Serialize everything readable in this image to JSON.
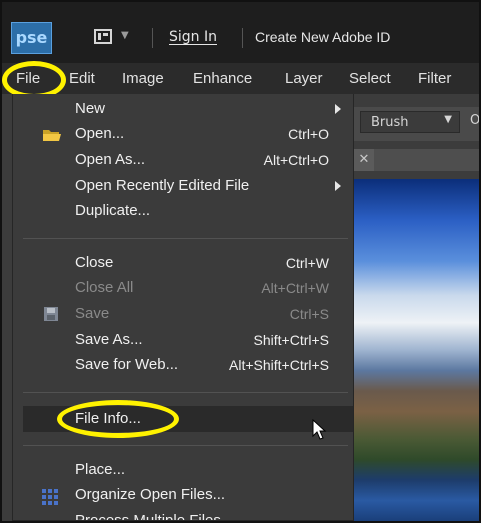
{
  "titlebar": {
    "app_logo": "pse",
    "sign_in": "Sign In",
    "create_id": "Create New Adobe ID"
  },
  "menubar": {
    "items": [
      "File",
      "Edit",
      "Image",
      "Enhance",
      "Layer",
      "Select",
      "Filter"
    ]
  },
  "tool_options": {
    "brush_label": "Brush",
    "trailing_text": "O"
  },
  "file_menu": {
    "items": [
      {
        "label": "New",
        "shortcut": "",
        "submenu": true,
        "enabled": true
      },
      {
        "label": "Open...",
        "shortcut": "Ctrl+O",
        "submenu": false,
        "enabled": true,
        "icon": "folder-icon"
      },
      {
        "label": "Open As...",
        "shortcut": "Alt+Ctrl+O",
        "submenu": false,
        "enabled": true
      },
      {
        "label": "Open Recently Edited File",
        "shortcut": "",
        "submenu": true,
        "enabled": true
      },
      {
        "label": "Duplicate...",
        "shortcut": "",
        "submenu": false,
        "enabled": true
      },
      {
        "label": "Close",
        "shortcut": "Ctrl+W",
        "submenu": false,
        "enabled": true
      },
      {
        "label": "Close All",
        "shortcut": "Alt+Ctrl+W",
        "submenu": false,
        "enabled": false
      },
      {
        "label": "Save",
        "shortcut": "Ctrl+S",
        "submenu": false,
        "enabled": false,
        "icon": "save-icon"
      },
      {
        "label": "Save As...",
        "shortcut": "Shift+Ctrl+S",
        "submenu": false,
        "enabled": true
      },
      {
        "label": "Save for Web...",
        "shortcut": "Alt+Shift+Ctrl+S",
        "submenu": false,
        "enabled": true
      },
      {
        "label": "File Info...",
        "shortcut": "",
        "submenu": false,
        "enabled": true,
        "highlighted": true
      },
      {
        "label": "Place...",
        "shortcut": "",
        "submenu": false,
        "enabled": true
      },
      {
        "label": "Organize Open Files...",
        "shortcut": "",
        "submenu": false,
        "enabled": true,
        "icon": "grid-icon"
      },
      {
        "label": "Process Multiple Files...",
        "shortcut": "",
        "submenu": false,
        "enabled": true
      }
    ]
  },
  "colors": {
    "highlight_ring": "#fff200",
    "menu_bg": "#3b3b3b",
    "logo_blue": "#2c6ea8"
  }
}
